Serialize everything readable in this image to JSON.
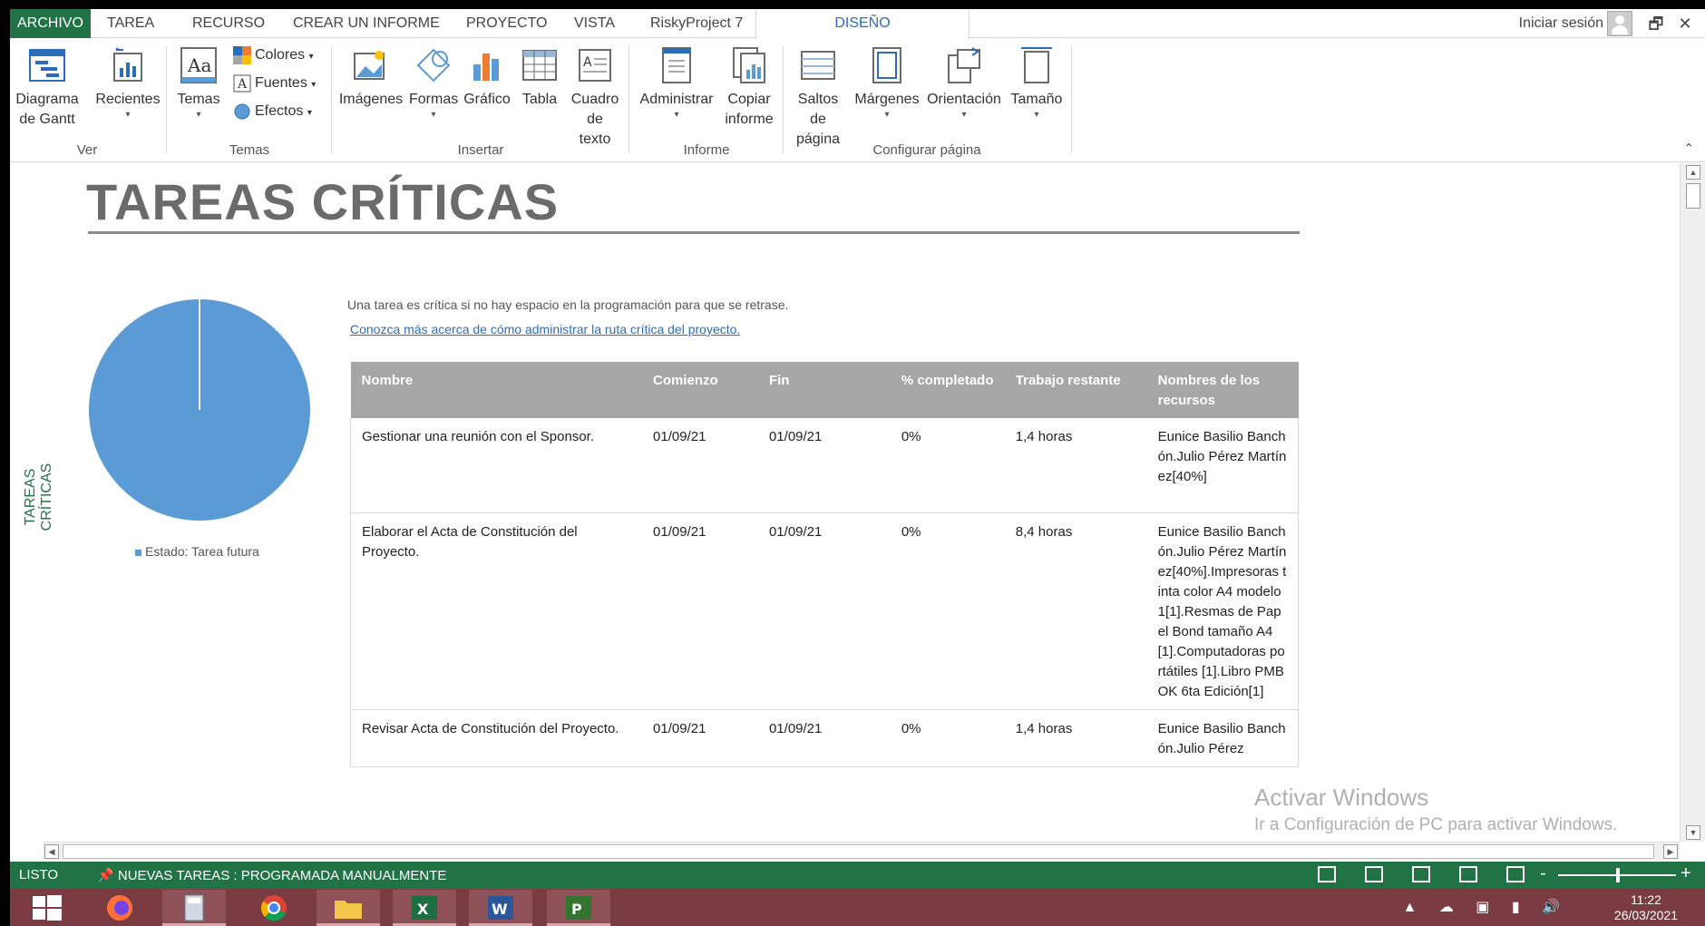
{
  "tabs": {
    "file": "ARCHIVO",
    "task": "TAREA",
    "resource": "RECURSO",
    "report": "CREAR UN INFORME",
    "project": "PROYECTO",
    "view": "VISTA",
    "risky": "RiskyProject 7",
    "design": "DISEÑO"
  },
  "signin": "Iniciar sesión",
  "window_controls": {
    "restore": "🗗",
    "close": "✕"
  },
  "ribbon": {
    "gantt": "Diagrama de Gantt",
    "recent": "Recientes",
    "themes": "Temas",
    "colors": "Colores",
    "fonts": "Fuentes",
    "effects": "Efectos",
    "images": "Imágenes",
    "shapes": "Formas",
    "chart": "Gráfico",
    "table": "Tabla",
    "textbox": "Cuadro de texto",
    "manage": "Administrar",
    "copy_report": "Copiar informe",
    "page_breaks": "Saltos de página",
    "margins": "Márgenes",
    "orientation": "Orientación",
    "size": "Tamaño",
    "groups": {
      "view": "Ver",
      "themes": "Temas",
      "insert": "Insertar",
      "report": "Informe",
      "page_setup": "Configurar página"
    }
  },
  "report": {
    "title": "TAREAS CRÍTICAS",
    "side_label": "TAREAS CRÍTICAS",
    "description": "Una tarea es crítica si no hay espacio en la programación para que se retrase.",
    "link": "Conozca más acerca de cómo administrar la ruta crítica del proyecto.",
    "legend": "Estado: Tarea futura",
    "pie_color": "#5b9bd5",
    "columns": [
      "Nombre",
      "Comienzo",
      "Fin",
      "% completado",
      "Trabajo restante",
      "Nombres de los recursos"
    ],
    "rows": [
      {
        "name": "Gestionar una reunión con el Sponsor.",
        "start": "01/09/21",
        "end": "01/09/21",
        "pct": "0%",
        "work": "1,4 horas",
        "resources": "Eunice Basilio Banchón.Julio Pérez Martínez[40%]"
      },
      {
        "name": "Elaborar el Acta de Constitución del Proyecto.",
        "start": "01/09/21",
        "end": "01/09/21",
        "pct": "0%",
        "work": "8,4 horas",
        "resources": "Eunice Basilio Banchón.Julio Pérez Martínez[40%].Impresoras tinta color A4 modelo 1[1].Resmas de Papel Bond tamaño A4[1].Computadoras portátiles [1].Libro PMBOK 6ta Edición[1]"
      },
      {
        "name": "Revisar Acta de Constitución del Proyecto.",
        "start": "01/09/21",
        "end": "01/09/21",
        "pct": "0%",
        "work": "1,4 horas",
        "resources": "Eunice Basilio Banchón.Julio Pérez"
      }
    ]
  },
  "watermark": {
    "line1": "Activar Windows",
    "line2": "Ir a Configuración de PC para activar Windows."
  },
  "status": {
    "ready": "LISTO",
    "mode": "NUEVAS TAREAS : PROGRAMADA MANUALMENTE"
  },
  "taskbar": {
    "time": "11:22",
    "date": "26/03/2021"
  }
}
